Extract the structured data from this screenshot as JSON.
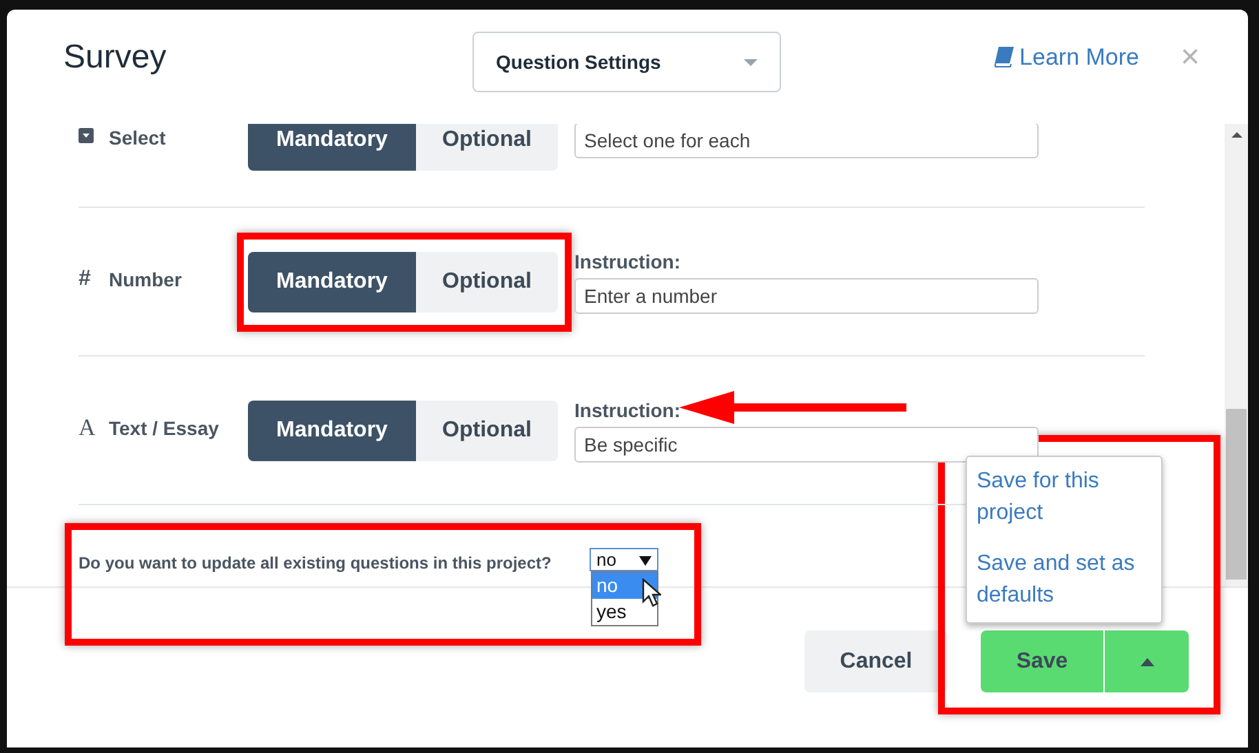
{
  "modal": {
    "title": "Survey",
    "settings_dropdown": {
      "value": "Question Settings"
    },
    "learn_more": "Learn More",
    "close": "×"
  },
  "question_types": [
    {
      "kind": "select",
      "label": "Select",
      "options": [
        {
          "label": "Mandatory",
          "selected": true
        },
        {
          "label": "Optional",
          "selected": false
        }
      ],
      "instruction": "Select one for each"
    },
    {
      "kind": "number",
      "icon": "#",
      "label": "Number",
      "options": [
        {
          "label": "Mandatory",
          "selected": true
        },
        {
          "label": "Optional",
          "selected": false
        }
      ],
      "instruction_label": "Instruction:",
      "instruction": "Enter a number"
    },
    {
      "kind": "text",
      "icon": "A",
      "label": "Text / Essay",
      "options": [
        {
          "label": "Mandatory",
          "selected": true
        },
        {
          "label": "Optional",
          "selected": false
        }
      ],
      "instruction_label": "Instruction:",
      "instruction": "Be specific"
    }
  ],
  "update_question": {
    "text": "Do you want to update all existing questions in this project?",
    "value": "no",
    "expanded": true,
    "options": [
      {
        "label": "no",
        "selected": true
      },
      {
        "label": "yes",
        "selected": false
      }
    ]
  },
  "footer": {
    "cancel": "Cancel",
    "save": "Save",
    "save_menu": {
      "expanded": true,
      "items": [
        "Save for this project",
        "Save and set as defaults"
      ]
    }
  },
  "annotations": [
    {
      "kind": "box"
    },
    {
      "kind": "arrow"
    },
    {
      "kind": "box"
    },
    {
      "kind": "box"
    }
  ]
}
